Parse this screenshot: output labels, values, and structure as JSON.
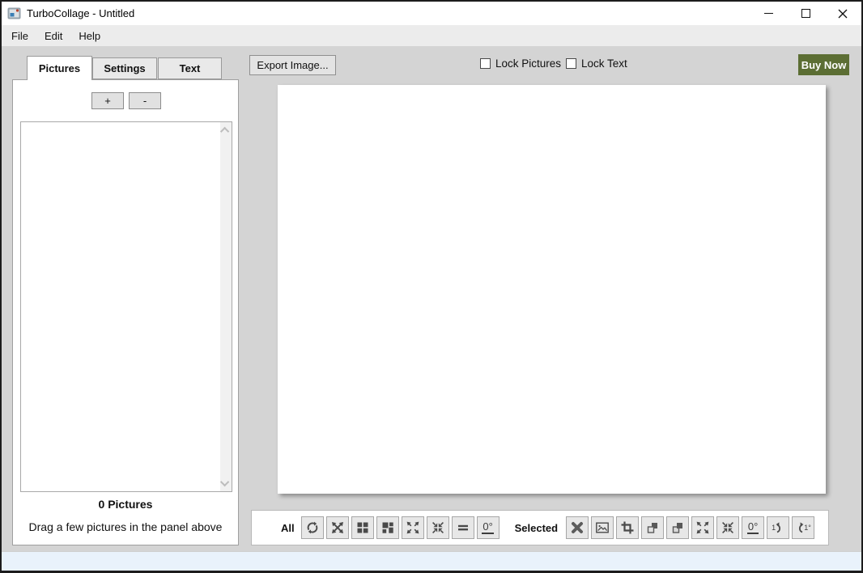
{
  "window": {
    "title": "TurboCollage - Untitled",
    "controls": [
      "minimize",
      "maximize",
      "close"
    ]
  },
  "menu": {
    "items": {
      "file": "File",
      "edit": "Edit",
      "help": "Help"
    }
  },
  "sidebar": {
    "tabs": {
      "pictures": "Pictures",
      "settings": "Settings",
      "text": "Text"
    },
    "active_tab": "Pictures",
    "add_button": "+",
    "remove_button": "-",
    "picture_list": [],
    "count_text": "0 Pictures",
    "hint_text": "Drag a few pictures in the panel above"
  },
  "topbar": {
    "export_button": "Export Image...",
    "lock_pictures": {
      "label": "Lock Pictures",
      "checked": false
    },
    "lock_text": {
      "label": "Lock Text",
      "checked": false
    },
    "buy_now": {
      "label": "Buy Now",
      "color": "#5c6e34"
    }
  },
  "canvas": {
    "content": "empty white collage canvas"
  },
  "toolbar": {
    "all": {
      "label": "All",
      "buttons": [
        "regenerate-icon",
        "shuffle-pictures-icon",
        "grid-equal-icon",
        "grid-mosaic-icon",
        "spread-pictures-icon",
        "gather-pictures-icon",
        "equal-size-icon",
        "rotate-0-button"
      ]
    },
    "selected": {
      "label": "Selected",
      "buttons": [
        "delete-icon",
        "replace-picture-icon",
        "crop-icon",
        "send-backward-icon",
        "bring-forward-icon",
        "enlarge-icon",
        "shrink-icon",
        "rotate-0-button",
        "rotate-left-1-icon",
        "rotate-right-1-icon"
      ]
    },
    "rotate_zero": "0°",
    "rotate_one_left": "1",
    "rotate_one_right": "1°"
  }
}
